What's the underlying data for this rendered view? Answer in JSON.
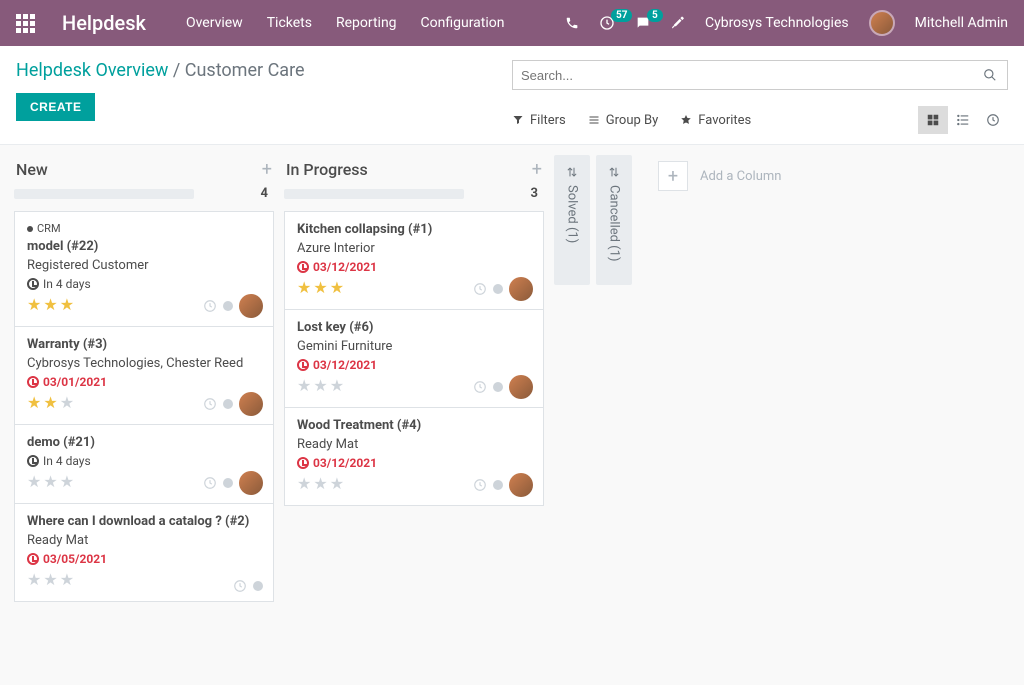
{
  "top": {
    "brand": "Helpdesk",
    "menu": [
      "Overview",
      "Tickets",
      "Reporting",
      "Configuration"
    ],
    "clock_badge": "57",
    "chat_badge": "5",
    "company": "Cybrosys Technologies",
    "user": "Mitchell Admin"
  },
  "breadcrumb": {
    "root": "Helpdesk Overview",
    "sep": " / ",
    "current": "Customer Care"
  },
  "create_label": "CREATE",
  "search": {
    "placeholder": "Search..."
  },
  "toolbar": {
    "filters": "Filters",
    "groupby": "Group By",
    "favorites": "Favorites"
  },
  "columns": [
    {
      "title": "New",
      "count": "4",
      "cards": [
        {
          "tag": "CRM",
          "title": "model (#22)",
          "sub": "Registered Customer",
          "due": "In 4 days",
          "due_red": false,
          "stars": 3,
          "has_avatar": true
        },
        {
          "title": "Warranty (#3)",
          "sub": "Cybrosys Technologies, Chester Reed",
          "due": "03/01/2021",
          "due_red": true,
          "stars": 2,
          "has_avatar": true
        },
        {
          "title": "demo (#21)",
          "sub": "",
          "due": "In 4 days",
          "due_red": false,
          "stars": 0,
          "has_avatar": true
        },
        {
          "title": "Where can I download a catalog ? (#2)",
          "sub": "Ready Mat",
          "due": "03/05/2021",
          "due_red": true,
          "stars": 0,
          "has_avatar": false
        }
      ]
    },
    {
      "title": "In Progress",
      "count": "3",
      "cards": [
        {
          "title": "Kitchen collapsing (#1)",
          "sub": "Azure Interior",
          "due": "03/12/2021",
          "due_red": true,
          "stars": 3,
          "has_avatar": true
        },
        {
          "title": "Lost key (#6)",
          "sub": "Gemini Furniture",
          "due": "03/12/2021",
          "due_red": true,
          "stars": 0,
          "has_avatar": true
        },
        {
          "title": "Wood Treatment (#4)",
          "sub": "Ready Mat",
          "due": "03/12/2021",
          "due_red": true,
          "stars": 0,
          "has_avatar": true
        }
      ]
    }
  ],
  "folded": [
    {
      "label": "Solved (1)"
    },
    {
      "label": "Cancelled (1)"
    }
  ],
  "add_column": "Add a Column"
}
